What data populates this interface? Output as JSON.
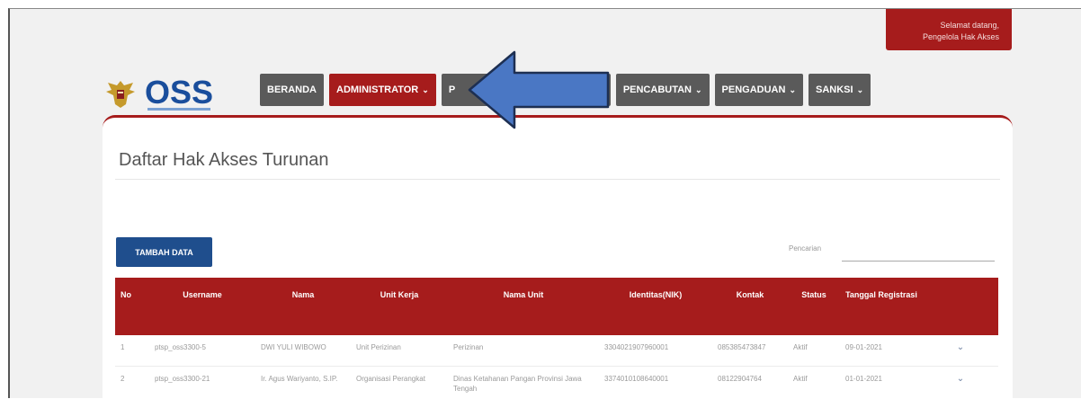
{
  "header": {
    "greeting_line1": "Selamat datang,",
    "greeting_line2": "Pengelola Hak Akses",
    "logo_text": "OSS"
  },
  "nav": [
    {
      "label": "BERANDA",
      "dropdown": false,
      "active": false
    },
    {
      "label": "ADMINISTRATOR",
      "dropdown": true,
      "active": true
    },
    {
      "label": "P",
      "dropdown": true,
      "active": false
    },
    {
      "label": "PENCABUTAN",
      "dropdown": true,
      "active": false
    },
    {
      "label": "PENGADUAN",
      "dropdown": true,
      "active": false
    },
    {
      "label": "SANKSI",
      "dropdown": true,
      "active": false
    }
  ],
  "page": {
    "title": "Daftar Hak Akses Turunan",
    "add_button": "TAMBAH DATA",
    "search_label": "Pencarian",
    "search_value": ""
  },
  "table": {
    "headers": [
      "No",
      "Username",
      "Nama",
      "Unit Kerja",
      "Nama Unit",
      "Identitas(NIK)",
      "Kontak",
      "Status",
      "Tanggal Registrasi"
    ],
    "rows": [
      [
        "1",
        "ptsp_oss3300-5",
        "DWI YULI WIBOWO",
        "Unit Perizinan",
        "Perizinan",
        "3304021907960001",
        "085385473847",
        "Aktif",
        "09-01-2021"
      ],
      [
        "2",
        "ptsp_oss3300-21",
        "Ir. Agus Wariyanto, S.IP.",
        "Organisasi Perangkat",
        "Dinas Ketahanan Pangan Provinsi Jawa Tengah",
        "3374010108640001",
        "08122904764",
        "Aktif",
        "01-01-2021"
      ]
    ]
  },
  "colors": {
    "brand_red": "#a61c1c",
    "nav_gray": "#5a5a5a",
    "button_blue": "#1f4e8d",
    "arrow_blue": "#4a77c4"
  }
}
